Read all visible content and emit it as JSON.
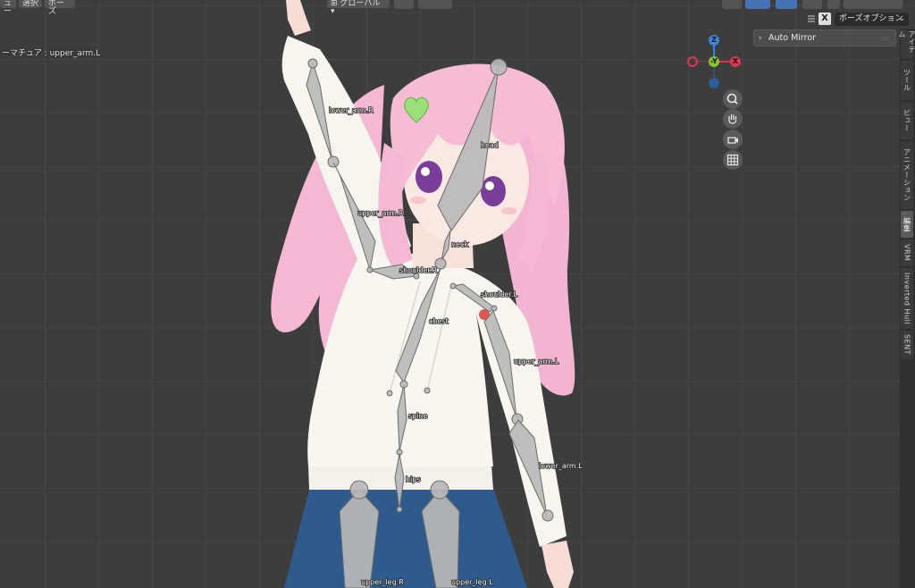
{
  "header": {
    "menu_view": "ュー",
    "menu_select": "選択",
    "menu_pose": "ポーズ",
    "orientation": "グローバル",
    "pose_options": "ポーズオプション",
    "close_label": "X"
  },
  "overlay": {
    "active_object": "ーマチュア : upper_arm.L"
  },
  "gizmo": {
    "z": "Z",
    "y": "-Y",
    "x": "X"
  },
  "panel": {
    "auto_mirror": "Auto Mirror"
  },
  "side_tabs": [
    {
      "label": "アイテム"
    },
    {
      "label": "ツール"
    },
    {
      "label": "ビュー"
    },
    {
      "label": "アニメーション"
    },
    {
      "label": "編集"
    },
    {
      "label": "VRM"
    },
    {
      "label": "Inverted Hull"
    },
    {
      "label": "SENT"
    }
  ],
  "bones": {
    "lower_arm_R": "lower_arm.R",
    "head": "head",
    "upper_arm_R": "upper_arm.R",
    "neck": "neck",
    "shoulder_R": "shoulder.R",
    "shoulder_L": "shoulder.L",
    "chest": "chest",
    "upper_arm_L": "upper_arm.L",
    "spine": "spine",
    "lower_arm_L": "lower_arm.L",
    "hips": "hips",
    "upper_leg_R": "upper_leg.R",
    "upper_leg_L": "upper_leg.L"
  },
  "colors": {
    "grid_bg": "#3d3d3d",
    "axis_x": "#e0344e",
    "axis_y": "#86c530",
    "axis_z": "#3c84d8",
    "bone": "#b8b8b8",
    "accent": "#4772b3"
  }
}
